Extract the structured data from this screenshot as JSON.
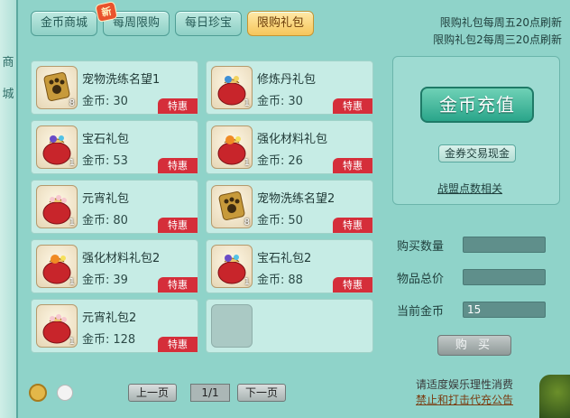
{
  "left_deco": {
    "chars": [
      "商",
      "城"
    ]
  },
  "tabs": [
    {
      "label": "金币商城",
      "active": false
    },
    {
      "label": "每周限购",
      "active": false,
      "badge": "新"
    },
    {
      "label": "每日珍宝",
      "active": false
    },
    {
      "label": "限购礼包",
      "active": true
    }
  ],
  "notes": {
    "line1": "限购礼包每周五20点刷新",
    "line2": "限购礼包2每周三20点刷新"
  },
  "items": [
    {
      "name": "宠物洗练名望1",
      "currency": "金币:",
      "price": "30",
      "count": "8",
      "tag": "特惠",
      "icon": "paw-badge-icon"
    },
    {
      "name": "修炼丹礼包",
      "currency": "金币:",
      "price": "30",
      "count": "1",
      "tag": "特惠",
      "icon": "red-bag-icon"
    },
    {
      "name": "宝石礼包",
      "currency": "金币:",
      "price": "53",
      "count": "1",
      "tag": "特惠",
      "icon": "red-bag-icon"
    },
    {
      "name": "强化材料礼包",
      "currency": "金币:",
      "price": "26",
      "count": "1",
      "tag": "特惠",
      "icon": "red-bag-icon"
    },
    {
      "name": "元宵礼包",
      "currency": "金币:",
      "price": "80",
      "count": "1",
      "tag": "特惠",
      "icon": "red-bag-icon"
    },
    {
      "name": "宠物洗练名望2",
      "currency": "金币:",
      "price": "50",
      "count": "8",
      "tag": "特惠",
      "icon": "paw-badge-icon"
    },
    {
      "name": "强化材料礼包2",
      "currency": "金币:",
      "price": "39",
      "count": "1",
      "tag": "特惠",
      "icon": "red-bag-icon"
    },
    {
      "name": "宝石礼包2",
      "currency": "金币:",
      "price": "88",
      "count": "1",
      "tag": "特惠",
      "icon": "red-bag-icon"
    },
    {
      "name": "元宵礼包2",
      "currency": "金币:",
      "price": "128",
      "count": "1",
      "tag": "特惠",
      "icon": "red-bag-icon"
    }
  ],
  "side": {
    "recharge": "金币充值",
    "exchange": "金券交易现金",
    "alliance": "战盟点数相关"
  },
  "fields": {
    "quantity_label": "购买数量",
    "quantity_value": "",
    "total_label": "物品总价",
    "total_value": "",
    "gold_label": "当前金币",
    "gold_value": "15"
  },
  "buy_button": "购 买",
  "pager": {
    "prev": "上一页",
    "page": "1/1",
    "next": "下一页"
  },
  "footer": {
    "line1": "请适度娱乐理性消费",
    "line2": "禁止和打击代充公告"
  },
  "colors": {
    "accent": "#2aa58a",
    "tag_red": "#d52e3a",
    "active_tab": "#f6c65b"
  }
}
